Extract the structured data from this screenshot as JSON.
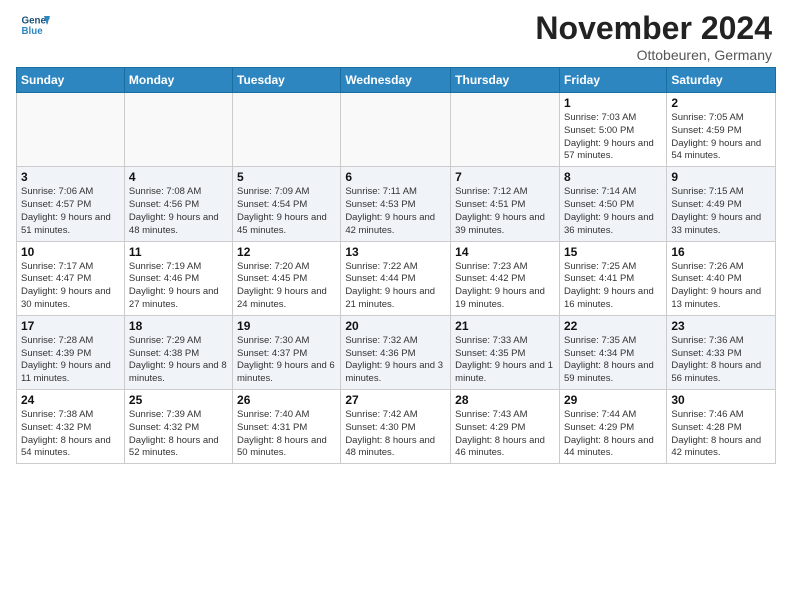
{
  "header": {
    "logo_line1": "General",
    "logo_line2": "Blue",
    "month_title": "November 2024",
    "location": "Ottobeuren, Germany"
  },
  "calendar": {
    "headers": [
      "Sunday",
      "Monday",
      "Tuesday",
      "Wednesday",
      "Thursday",
      "Friday",
      "Saturday"
    ],
    "weeks": [
      [
        {
          "day": "",
          "info": ""
        },
        {
          "day": "",
          "info": ""
        },
        {
          "day": "",
          "info": ""
        },
        {
          "day": "",
          "info": ""
        },
        {
          "day": "",
          "info": ""
        },
        {
          "day": "1",
          "info": "Sunrise: 7:03 AM\nSunset: 5:00 PM\nDaylight: 9 hours and 57 minutes."
        },
        {
          "day": "2",
          "info": "Sunrise: 7:05 AM\nSunset: 4:59 PM\nDaylight: 9 hours and 54 minutes."
        }
      ],
      [
        {
          "day": "3",
          "info": "Sunrise: 7:06 AM\nSunset: 4:57 PM\nDaylight: 9 hours and 51 minutes."
        },
        {
          "day": "4",
          "info": "Sunrise: 7:08 AM\nSunset: 4:56 PM\nDaylight: 9 hours and 48 minutes."
        },
        {
          "day": "5",
          "info": "Sunrise: 7:09 AM\nSunset: 4:54 PM\nDaylight: 9 hours and 45 minutes."
        },
        {
          "day": "6",
          "info": "Sunrise: 7:11 AM\nSunset: 4:53 PM\nDaylight: 9 hours and 42 minutes."
        },
        {
          "day": "7",
          "info": "Sunrise: 7:12 AM\nSunset: 4:51 PM\nDaylight: 9 hours and 39 minutes."
        },
        {
          "day": "8",
          "info": "Sunrise: 7:14 AM\nSunset: 4:50 PM\nDaylight: 9 hours and 36 minutes."
        },
        {
          "day": "9",
          "info": "Sunrise: 7:15 AM\nSunset: 4:49 PM\nDaylight: 9 hours and 33 minutes."
        }
      ],
      [
        {
          "day": "10",
          "info": "Sunrise: 7:17 AM\nSunset: 4:47 PM\nDaylight: 9 hours and 30 minutes."
        },
        {
          "day": "11",
          "info": "Sunrise: 7:19 AM\nSunset: 4:46 PM\nDaylight: 9 hours and 27 minutes."
        },
        {
          "day": "12",
          "info": "Sunrise: 7:20 AM\nSunset: 4:45 PM\nDaylight: 9 hours and 24 minutes."
        },
        {
          "day": "13",
          "info": "Sunrise: 7:22 AM\nSunset: 4:44 PM\nDaylight: 9 hours and 21 minutes."
        },
        {
          "day": "14",
          "info": "Sunrise: 7:23 AM\nSunset: 4:42 PM\nDaylight: 9 hours and 19 minutes."
        },
        {
          "day": "15",
          "info": "Sunrise: 7:25 AM\nSunset: 4:41 PM\nDaylight: 9 hours and 16 minutes."
        },
        {
          "day": "16",
          "info": "Sunrise: 7:26 AM\nSunset: 4:40 PM\nDaylight: 9 hours and 13 minutes."
        }
      ],
      [
        {
          "day": "17",
          "info": "Sunrise: 7:28 AM\nSunset: 4:39 PM\nDaylight: 9 hours and 11 minutes."
        },
        {
          "day": "18",
          "info": "Sunrise: 7:29 AM\nSunset: 4:38 PM\nDaylight: 9 hours and 8 minutes."
        },
        {
          "day": "19",
          "info": "Sunrise: 7:30 AM\nSunset: 4:37 PM\nDaylight: 9 hours and 6 minutes."
        },
        {
          "day": "20",
          "info": "Sunrise: 7:32 AM\nSunset: 4:36 PM\nDaylight: 9 hours and 3 minutes."
        },
        {
          "day": "21",
          "info": "Sunrise: 7:33 AM\nSunset: 4:35 PM\nDaylight: 9 hours and 1 minute."
        },
        {
          "day": "22",
          "info": "Sunrise: 7:35 AM\nSunset: 4:34 PM\nDaylight: 8 hours and 59 minutes."
        },
        {
          "day": "23",
          "info": "Sunrise: 7:36 AM\nSunset: 4:33 PM\nDaylight: 8 hours and 56 minutes."
        }
      ],
      [
        {
          "day": "24",
          "info": "Sunrise: 7:38 AM\nSunset: 4:32 PM\nDaylight: 8 hours and 54 minutes."
        },
        {
          "day": "25",
          "info": "Sunrise: 7:39 AM\nSunset: 4:32 PM\nDaylight: 8 hours and 52 minutes."
        },
        {
          "day": "26",
          "info": "Sunrise: 7:40 AM\nSunset: 4:31 PM\nDaylight: 8 hours and 50 minutes."
        },
        {
          "day": "27",
          "info": "Sunrise: 7:42 AM\nSunset: 4:30 PM\nDaylight: 8 hours and 48 minutes."
        },
        {
          "day": "28",
          "info": "Sunrise: 7:43 AM\nSunset: 4:29 PM\nDaylight: 8 hours and 46 minutes."
        },
        {
          "day": "29",
          "info": "Sunrise: 7:44 AM\nSunset: 4:29 PM\nDaylight: 8 hours and 44 minutes."
        },
        {
          "day": "30",
          "info": "Sunrise: 7:46 AM\nSunset: 4:28 PM\nDaylight: 8 hours and 42 minutes."
        }
      ]
    ]
  }
}
